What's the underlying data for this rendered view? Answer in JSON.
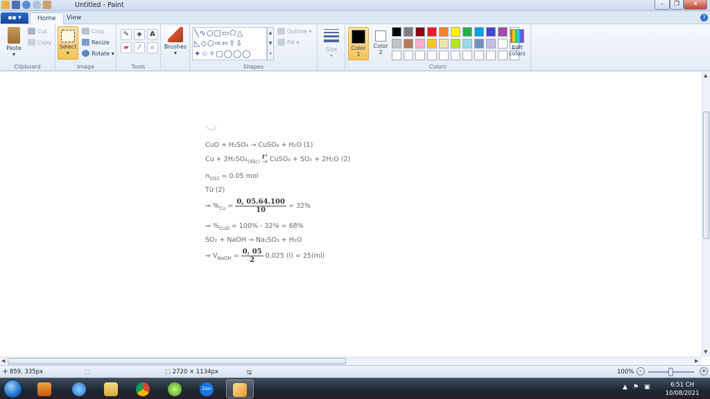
{
  "window": {
    "title": "Untitled - Paint"
  },
  "tabs": {
    "file_label": "▪▪ ▾",
    "home": "Home",
    "view": "View"
  },
  "ribbon": {
    "clipboard": {
      "label": "Clipboard",
      "paste": "Paste",
      "cut": "Cut",
      "copy": "Copy"
    },
    "image": {
      "label": "Image",
      "select": "Select",
      "crop": "Crop",
      "resize": "Resize",
      "rotate": "Rotate ▾"
    },
    "tools": {
      "label": "Tools"
    },
    "brushes": {
      "label": "Brushes"
    },
    "shapes": {
      "label": "Shapes",
      "outline": "Outline ▾",
      "fill": "Fill ▾"
    },
    "size": {
      "label": "Size"
    },
    "colors": {
      "label": "Colors",
      "color1": "Color\n1",
      "color1_a": "Color",
      "color1_b": "1",
      "color2_a": "Color",
      "color2_b": "2",
      "edit_a": "Edit",
      "edit_b": "colors",
      "color1_value": "#000000",
      "color2_value": "#ffffff",
      "palette": [
        "#000000",
        "#7f7f7f",
        "#880015",
        "#ed1c24",
        "#ff7f27",
        "#fff200",
        "#22b14c",
        "#00a2e8",
        "#3f48cc",
        "#a349a4",
        "#ffffff",
        "#c3c3c3",
        "#b97a57",
        "#ffaec9",
        "#ffc90e",
        "#efe4b0",
        "#b5e61d",
        "#99d9ea",
        "#7092be",
        "#c8bfe7"
      ]
    }
  },
  "document": {
    "line1": "CuO + H₂SO₄ → CuSO₄ + H₂O (1)",
    "line2_a": "Cu + 2H₂SO₄",
    "line2_sub": "(đặc)",
    "line2_arrow": "t°",
    "line2_b": "CuSO₄ + SO₂ + 2H₂O (2)",
    "line3": "n",
    "line3_sub": "SO2",
    "line3_b": " = 0.05 mol",
    "line4": "Từ (2)",
    "line5_a": "⇒ %",
    "line5_sub": "Cu",
    "line5_eq": " = ",
    "line5_num": "0, 05.64.100",
    "line5_den": "10",
    "line5_b": " = 32%",
    "line6_a": "⇒ %",
    "line6_sub": "CuO",
    "line6_b": " = 100% - 32% = 68%",
    "line7": "SO₂ + NaOH → Na₂SO₃ + H₂O",
    "line8_a": "⇒ V",
    "line8_sub": "NaOH",
    "line8_eq": " = ",
    "line8_num": "0, 05",
    "line8_den": "2",
    "line8_b": " 0,025 (l) = 25(ml)"
  },
  "statusbar": {
    "cursor": "859, 335px",
    "canvas_size": "2720 × 1134px",
    "zoom": "100%"
  },
  "taskbar": {
    "clock_time": "6:51 CH",
    "clock_date": "10/08/2021",
    "zalo": "Zalo"
  }
}
